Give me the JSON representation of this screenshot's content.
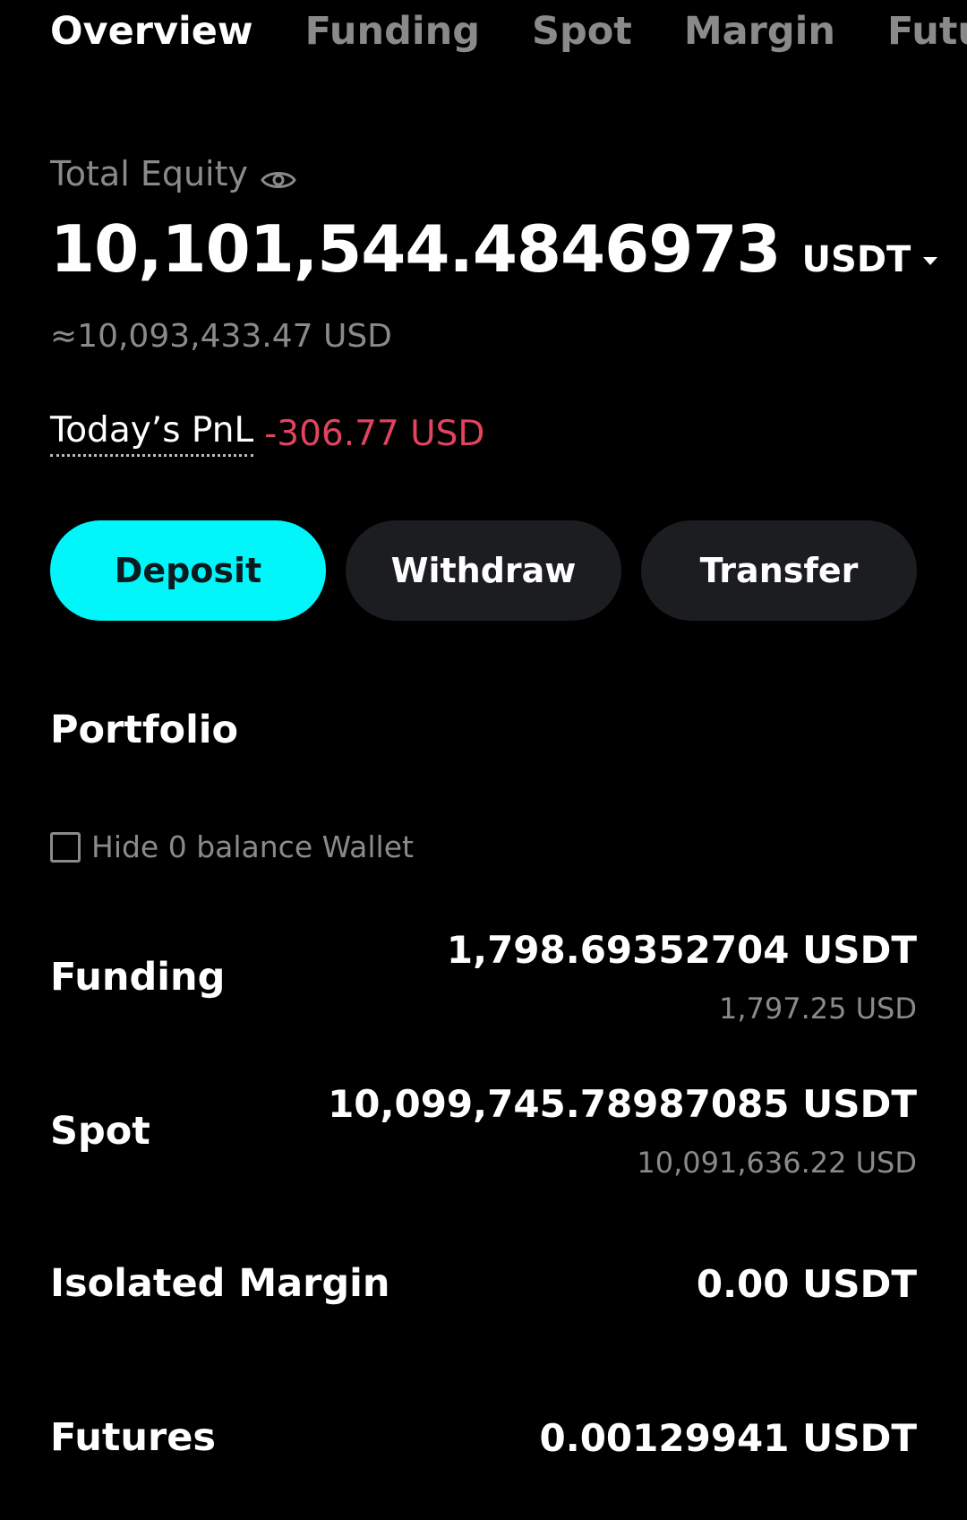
{
  "tabs": [
    {
      "label": "Overview",
      "active": true
    },
    {
      "label": "Funding",
      "active": false
    },
    {
      "label": "Spot",
      "active": false
    },
    {
      "label": "Margin",
      "active": false
    },
    {
      "label": "Futures",
      "active": false
    }
  ],
  "equity": {
    "label": "Total Equity",
    "value": "10,101,544.4846973",
    "currency": "USDT",
    "usd_approx": "≈10,093,433.47 USD"
  },
  "pnl": {
    "label": "Today’s PnL",
    "value": "-306.77 USD"
  },
  "actions": {
    "deposit": "Deposit",
    "withdraw": "Withdraw",
    "transfer": "Transfer"
  },
  "portfolio": {
    "title": "Portfolio",
    "hide_zero_label": "Hide 0 balance Wallet",
    "wallets": [
      {
        "name": "Funding",
        "usdt": "1,798.69352704 USDT",
        "usd": "1,797.25 USD"
      },
      {
        "name": "Spot",
        "usdt": "10,099,745.78987085 USDT",
        "usd": "10,091,636.22 USD"
      },
      {
        "name": "Isolated Margin",
        "usdt": "0.00 USDT",
        "usd": ""
      },
      {
        "name": "Futures",
        "usdt": "0.00129941 USDT",
        "usd": ""
      }
    ]
  },
  "colors": {
    "accent": "#00f6f9",
    "negative": "#e0445f",
    "muted": "#8a8a8a",
    "button_dark": "#1c1d20"
  }
}
